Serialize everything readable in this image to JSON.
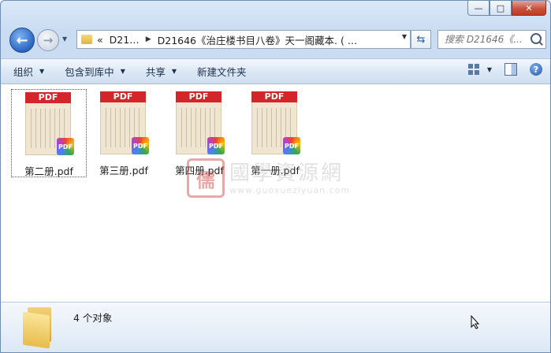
{
  "window": {
    "minimize": "—",
    "maximize": "□",
    "close": "✕"
  },
  "nav": {
    "back_icon": "←",
    "forward_icon": "→",
    "address": {
      "prefix": "«",
      "crumb1": "D21…",
      "crumb2": "D21646《治庄楼书目八卷》天一阁藏本. ( …"
    },
    "refresh_icon": "⇆",
    "search_placeholder": "搜索 D21646《..."
  },
  "toolbar": {
    "organize": "组织",
    "include_library": "包含到库中",
    "share": "共享",
    "new_folder": "新建文件夹",
    "help": "?"
  },
  "files": [
    {
      "name": "第二册.pdf",
      "badge": "PDF",
      "band": "PDF"
    },
    {
      "name": "第三册.pdf",
      "badge": "PDF",
      "band": "PDF"
    },
    {
      "name": "第四册.pdf",
      "badge": "PDF",
      "band": "PDF"
    },
    {
      "name": "第一册.pdf",
      "badge": "PDF",
      "band": "PDF"
    }
  ],
  "watermark": {
    "seal": "儒",
    "title": "國學資源網",
    "url": "www.guoxueziyuan.com"
  },
  "status": {
    "count": "4 个对象"
  }
}
